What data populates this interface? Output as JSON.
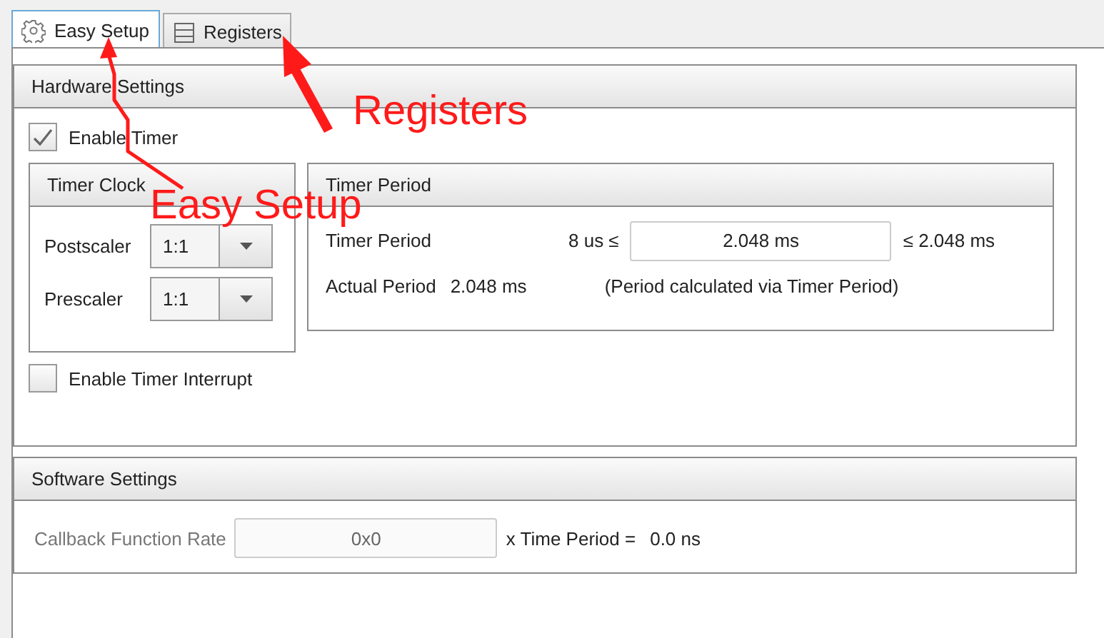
{
  "tabs": [
    {
      "label": "Easy Setup",
      "kind": "gear",
      "selected": true
    },
    {
      "label": "Registers",
      "kind": "list",
      "selected": false
    }
  ],
  "hardware_settings": {
    "title": "Hardware Settings",
    "enable_timer": {
      "label": "Enable Timer",
      "checked": true
    },
    "timer_clock": {
      "title": "Timer Clock",
      "fields": [
        {
          "label": "Postscaler",
          "value": "1:1"
        },
        {
          "label": "Prescaler",
          "value": "1:1"
        }
      ]
    },
    "timer_period": {
      "title": "Timer Period",
      "label": "Timer Period",
      "min": "8 us ≤",
      "value": "2.048 ms",
      "max": "≤ 2.048 ms",
      "actual_label": "Actual Period",
      "actual_value": "2.048 ms",
      "note": "(Period calculated via Timer Period)"
    },
    "enable_interrupt": {
      "label": "Enable Timer Interrupt",
      "checked": false
    }
  },
  "software_settings": {
    "title": "Software Settings",
    "label": "Callback Function Rate",
    "value": "0x0",
    "suffix": "x Time Period =",
    "result": "0.0 ns",
    "disabled": true
  },
  "annotations": [
    {
      "text": "Registers"
    },
    {
      "text": "Easy Setup"
    }
  ]
}
